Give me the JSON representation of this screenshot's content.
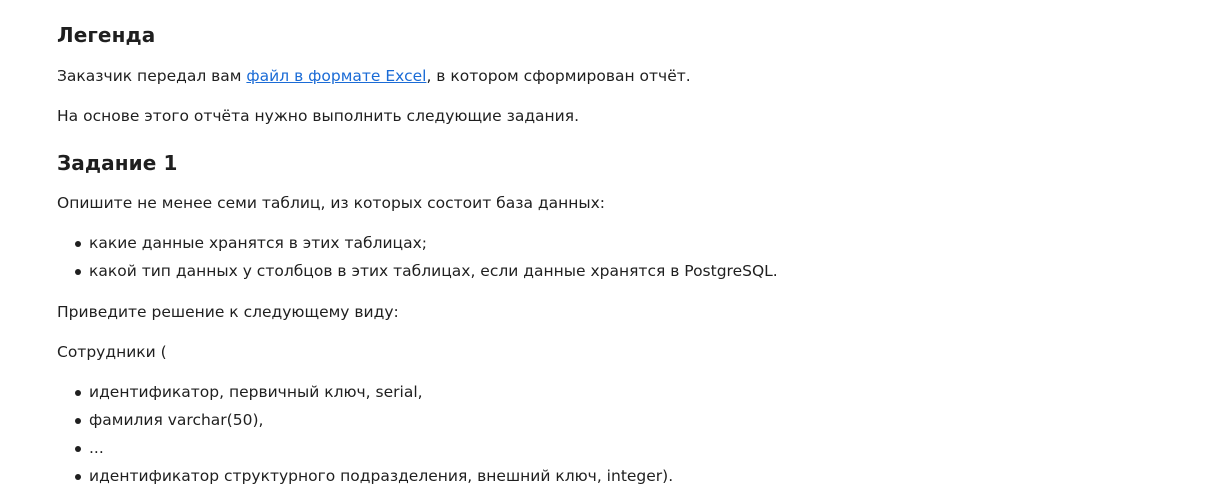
{
  "legend": {
    "heading": "Легенда",
    "para1": {
      "before": "Заказчик передал вам ",
      "link": "файл в формате Excel",
      "after": ", в котором сформирован отчёт."
    },
    "para2": "На основе этого отчёта нужно выполнить следующие задания."
  },
  "task1": {
    "heading": "Задание 1",
    "intro": "Опишите не менее семи таблиц, из которых состоит база данных:",
    "requirements": [
      "какие данные хранятся в этих таблицах;",
      "какой тип данных у столбцов в этих таблицах, если данные хранятся в PostgreSQL."
    ],
    "format_intro": "Приведите решение к следующему виду:",
    "example_table": "Сотрудники (",
    "example_columns": [
      "идентификатор, первичный ключ, serial,",
      "фамилия varchar(50),",
      "...",
      "идентификатор структурного подразделения, внешний ключ, integer)."
    ]
  }
}
